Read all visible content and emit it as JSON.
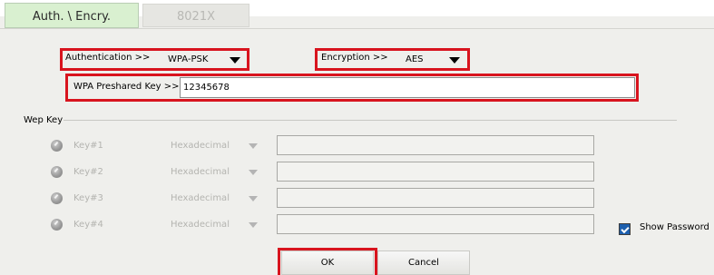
{
  "tabs": [
    {
      "label": "Auth. \\ Encry.",
      "active": true
    },
    {
      "label": "8021X",
      "active": false
    }
  ],
  "authentication": {
    "label": "Authentication >>",
    "value": "WPA-PSK"
  },
  "encryption": {
    "label": "Encryption >>",
    "value": "AES"
  },
  "preshared_key": {
    "label": "WPA Preshared Key >>",
    "value": "12345678"
  },
  "wep": {
    "group_label": "Wep Key",
    "keys": [
      {
        "label": "Key#1",
        "format": "Hexadecimal",
        "value": ""
      },
      {
        "label": "Key#2",
        "format": "Hexadecimal",
        "value": ""
      },
      {
        "label": "Key#3",
        "format": "Hexadecimal",
        "value": ""
      },
      {
        "label": "Key#4",
        "format": "Hexadecimal",
        "value": ""
      }
    ]
  },
  "show_password": {
    "label": "Show Password",
    "checked": true
  },
  "buttons": {
    "ok": "OK",
    "cancel": "Cancel"
  },
  "colors": {
    "highlight_border": "#d8141e",
    "active_tab": "#d9f0d0",
    "panel_bg": "#efefec",
    "checkbox": "#1d5fae"
  }
}
